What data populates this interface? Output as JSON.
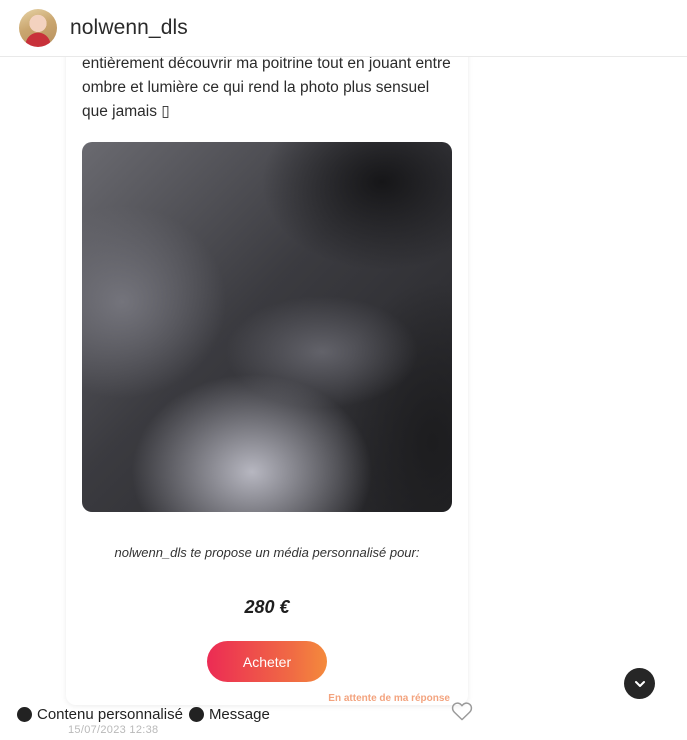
{
  "header": {
    "username": "nolwenn_dls"
  },
  "post": {
    "caption": "entièrement découvrir ma poitrine tout en jouant entre ombre et lumière ce qui rend la photo plus sensuel que jamais ▯",
    "offer_text": "nolwenn_dls te propose un média personnalisé pour:",
    "price": "280 €",
    "buy_label": "Acheter",
    "status": "En attente de ma réponse",
    "date": "15/07/2023 12:38"
  },
  "tags": [
    {
      "label": "Contenu personnalisé"
    },
    {
      "label": "Message"
    }
  ],
  "colors": {
    "button_gradient_start": "#ec2b54",
    "button_gradient_end": "#f48a3c",
    "status_text": "#f3a37e",
    "tag_dot": "#222222",
    "scroll_button": "#262626"
  },
  "icons": {
    "heart": "heart-outline-icon",
    "scroll": "chevron-down-icon"
  }
}
